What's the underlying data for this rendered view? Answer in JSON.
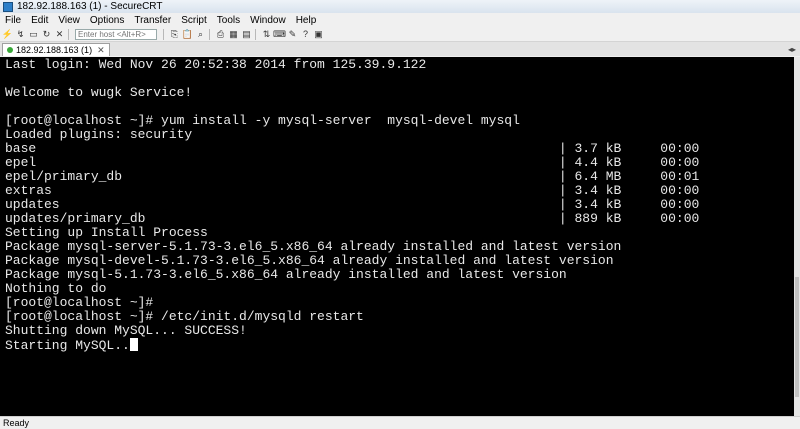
{
  "window": {
    "title": "182.92.188.163 (1) - SecureCRT"
  },
  "menubar": {
    "items": [
      "File",
      "Edit",
      "View",
      "Options",
      "Transfer",
      "Script",
      "Tools",
      "Window",
      "Help"
    ]
  },
  "toolbar": {
    "host_placeholder": "Enter host <Alt+R>"
  },
  "tabs": [
    {
      "label": "182.92.188.163 (1)"
    }
  ],
  "terminal": {
    "lines": [
      "Last login: Wed Nov 26 20:52:38 2014 from 125.39.9.122",
      "",
      "Welcome to wugk Service!",
      "",
      "[root@localhost ~]# yum install -y mysql-server  mysql-devel mysql",
      "Loaded plugins: security",
      "base                                                                   | 3.7 kB     00:00",
      "epel                                                                   | 4.4 kB     00:00",
      "epel/primary_db                                                        | 6.4 MB     00:01",
      "extras                                                                 | 3.4 kB     00:00",
      "updates                                                                | 3.4 kB     00:00",
      "updates/primary_db                                                     | 889 kB     00:00",
      "Setting up Install Process",
      "Package mysql-server-5.1.73-3.el6_5.x86_64 already installed and latest version",
      "Package mysql-devel-5.1.73-3.el6_5.x86_64 already installed and latest version",
      "Package mysql-5.1.73-3.el6_5.x86_64 already installed and latest version",
      "Nothing to do",
      "[root@localhost ~]#",
      "[root@localhost ~]# /etc/init.d/mysqld restart",
      "Shutting down MySQL... SUCCESS!",
      "Starting MySQL.."
    ]
  },
  "statusbar": {
    "text": "Ready"
  },
  "colors": {
    "terminal_bg": "#000000",
    "terminal_fg": "#e8e8e8"
  }
}
